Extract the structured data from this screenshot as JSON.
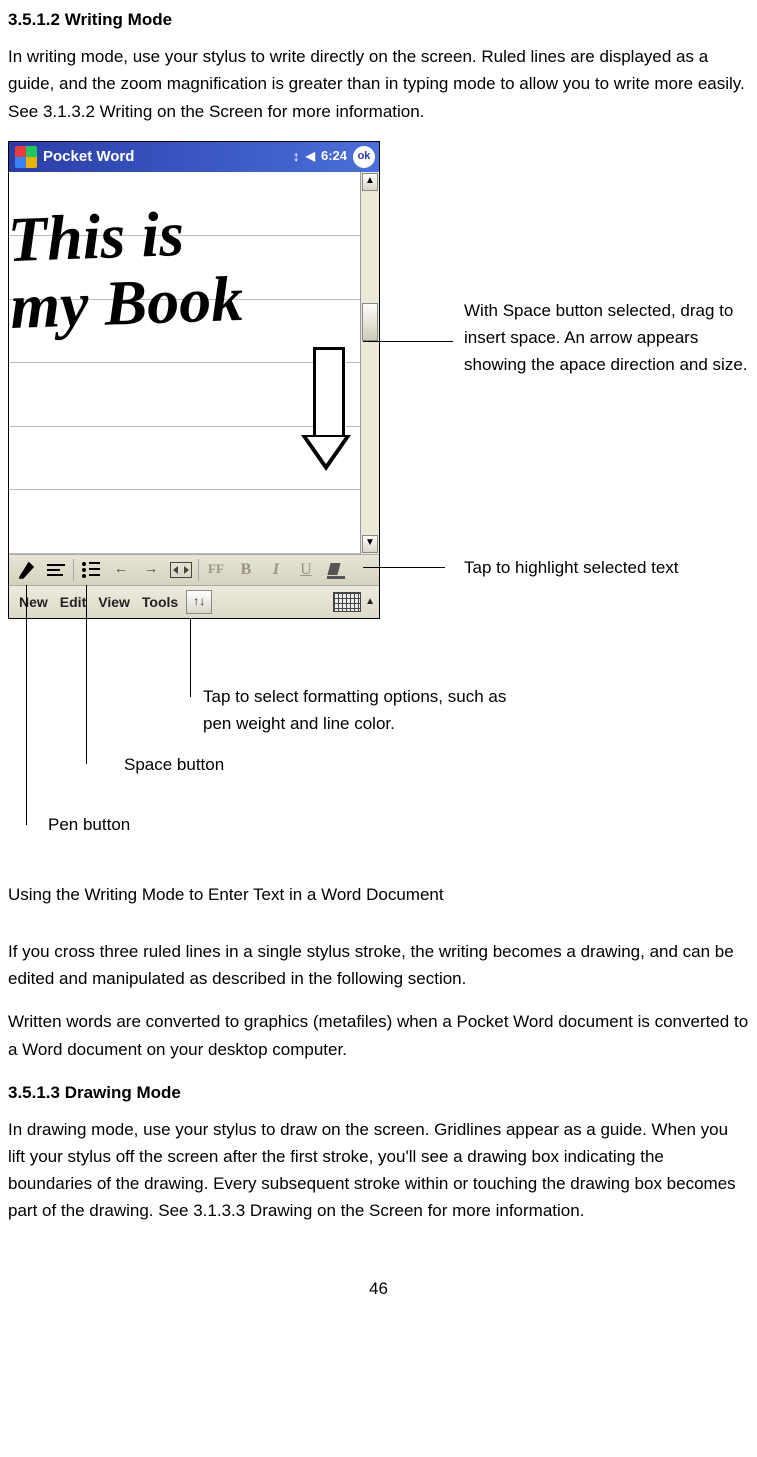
{
  "section1": {
    "heading": "3.5.1.2 Writing Mode",
    "para": "In writing mode, use your stylus to write directly on the screen. Ruled lines are displayed as a guide, and the zoom magnification is greater than in typing mode to allow you to write more easily. See 3.1.3.2 Writing on the Screen for more information."
  },
  "device": {
    "app_title": "Pocket Word",
    "time": "6:24",
    "ok": "ok",
    "handwriting": "This is\nmy Book",
    "fmt": {
      "ff": "FF",
      "b": "B",
      "i": "I",
      "u": "U"
    },
    "menu": {
      "new": "New",
      "edit": "Edit",
      "view": "View",
      "tools": "Tools",
      "arrows": "↑↓"
    }
  },
  "callouts": {
    "space_drag": "With Space button selected, drag to insert space. An arrow appears showing the apace direction and size.",
    "highlight": "Tap to highlight selected text",
    "tools": "Tap to select formatting options, such as pen weight and line color.",
    "space_btn": "Space button",
    "pen_btn": "Pen button"
  },
  "subheading": "Using the Writing Mode to Enter Text in a Word Document",
  "para2": "If you cross three ruled lines in a single stylus stroke, the writing becomes a drawing, and can be edited and manipulated as described in the following section.",
  "para3": "Written words are converted to graphics (metafiles) when a Pocket Word document is converted to a Word document on your desktop computer.",
  "section2": {
    "heading": "3.5.1.3 Drawing Mode",
    "para": "In drawing mode, use your stylus to draw on the screen. Gridlines appear as a guide. When you lift your stylus off the screen after the first stroke, you'll see a drawing box indicating the boundaries of the drawing. Every subsequent stroke within or touching the drawing box becomes part of the drawing. See 3.1.3.3 Drawing on the Screen for more information."
  },
  "page_number": "46"
}
